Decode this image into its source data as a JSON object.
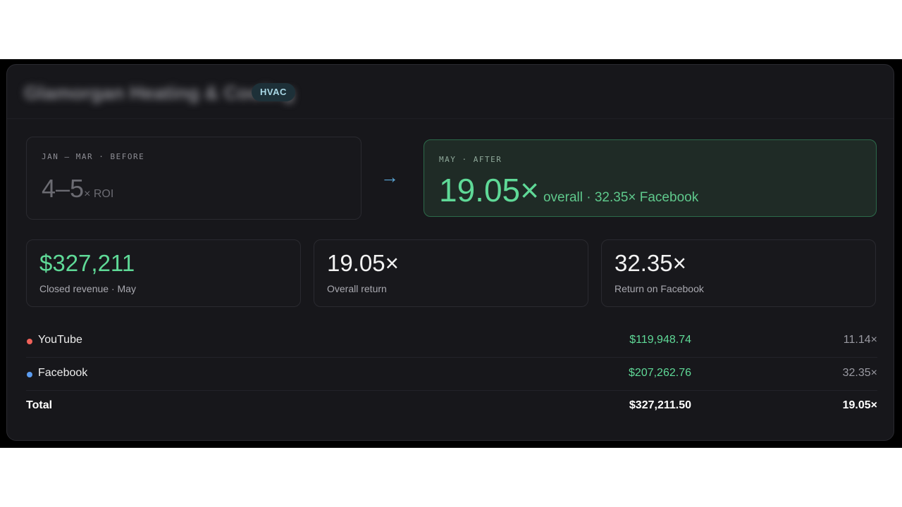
{
  "header": {
    "company_name": "Glamorgan Heating & Cooling",
    "badge": "HVAC"
  },
  "before": {
    "label": "JAN – MAR · BEFORE",
    "value": "4–5",
    "unit": "× ROI"
  },
  "arrow": "→",
  "after": {
    "label": "MAY · AFTER",
    "value": "19.05×",
    "detail": "overall · 32.35× Facebook"
  },
  "stats": [
    {
      "value": "$327,211",
      "label": "Closed revenue · May"
    },
    {
      "value": "19.05×",
      "label": "Overall return"
    },
    {
      "value": "32.35×",
      "label": "Return on Facebook"
    }
  ],
  "channels": [
    {
      "name": "YouTube",
      "amount": "$119,948.74",
      "multiple": "11.14×",
      "color": "#f0625a"
    },
    {
      "name": "Facebook",
      "amount": "$207,262.76",
      "multiple": "32.35×",
      "color": "#5b9cf0"
    }
  ],
  "total": {
    "name": "Total",
    "amount": "$327,211.50",
    "multiple": "19.05×"
  },
  "colors": {
    "accent_green": "#5fd997",
    "background": "#17171b",
    "youtube": "#f0625a",
    "facebook": "#5b9cf0"
  }
}
